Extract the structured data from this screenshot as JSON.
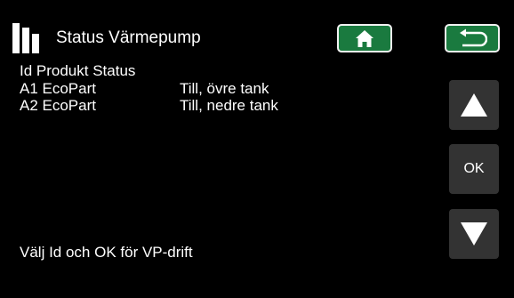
{
  "header": {
    "title": "Status Värmepump",
    "home_icon": "home-icon",
    "back_icon": "back-arrow-icon",
    "accent_color": "#1a7a3f"
  },
  "table": {
    "header": "Id Produkt Status",
    "rows": [
      {
        "id_product": "A1 EcoPart",
        "status": "Till, övre tank"
      },
      {
        "id_product": "A2 EcoPart",
        "status": "Till, nedre tank"
      }
    ]
  },
  "hint": "Välj Id och OK för VP-drift",
  "side": {
    "up_icon": "arrow-up-icon",
    "ok_label": "OK",
    "down_icon": "arrow-down-icon"
  }
}
